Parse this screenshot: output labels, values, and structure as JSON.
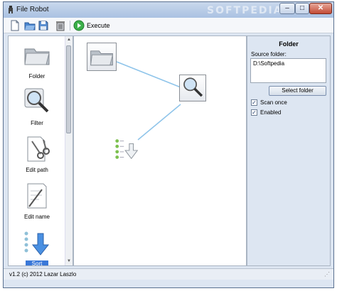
{
  "window": {
    "title": "File Robot",
    "watermark": "SOFTPEDIA",
    "minimize": "–",
    "maximize": "□",
    "close": "✕"
  },
  "toolbar": {
    "buttons": [
      {
        "icon": "new-document-icon"
      },
      {
        "icon": "open-folder-icon"
      },
      {
        "icon": "save-icon"
      },
      {
        "icon": "delete-icon"
      }
    ],
    "execute_label": "Execute",
    "execute_icon": "play-icon"
  },
  "palette": {
    "items": [
      {
        "label": "Folder",
        "icon": "folder-icon"
      },
      {
        "label": "Filter",
        "icon": "magnifier-icon"
      },
      {
        "label": "Edit path",
        "icon": "scissors-icon"
      },
      {
        "label": "Edit name",
        "icon": "pen-paper-icon"
      },
      {
        "label": "Sort",
        "icon": "sort-arrow-icon",
        "selected": true
      }
    ],
    "scroll_up": "▲",
    "scroll_down": "▼"
  },
  "canvas": {
    "nodes": [
      {
        "name": "Folder",
        "icon": "folder-icon"
      },
      {
        "name": "Filter",
        "icon": "magnifier-icon"
      },
      {
        "name": "Sort",
        "icon": "sort-arrow-icon"
      }
    ]
  },
  "properties": {
    "title": "Folder",
    "source_label": "Source folder:",
    "source_value": "D:\\Softpedia",
    "select_button": "Select folder",
    "scan_once": {
      "label": "Scan once",
      "checked": true
    },
    "enabled": {
      "label": "Enabled",
      "checked": true
    }
  },
  "status": {
    "text": "v1.2 (c) 2012 Lazar Laszlo"
  },
  "colors": {
    "accent": "#3a78d8",
    "connector": "#8ec4ea",
    "titlebar": "#aac2e2"
  }
}
